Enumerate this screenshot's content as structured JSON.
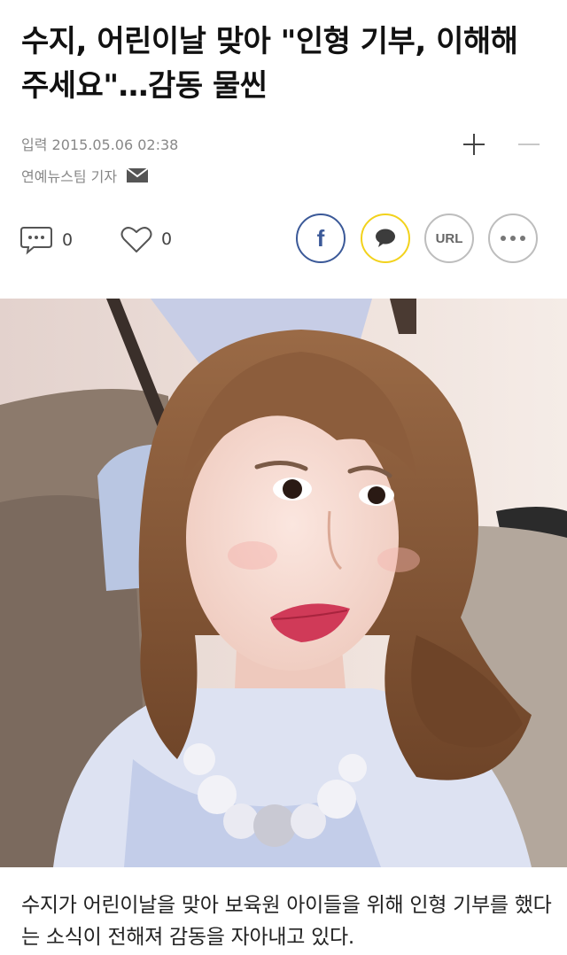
{
  "article": {
    "headline": "수지, 어린이날 맞아 \"인형 기부, 이해해 주세요\"…감동 물씬",
    "date_label": "입력 2015.05.06 02:38",
    "author": "연예뉴스팀 기자",
    "body_text": "수지가 어린이날을 맞아 보육원 아이들을 위해 인형 기부를 했다는 소식이 전해져 감동을 자아내고 있다."
  },
  "font_controls": {
    "increase_icon": "plus-icon",
    "decrease_icon": "minus-icon"
  },
  "engagement": {
    "comment_count": "0",
    "like_count": "0"
  },
  "share": {
    "facebook_glyph": "f",
    "url_label": "URL",
    "facebook_color": "#3b5998",
    "kakao_color": "#f2d21c"
  },
  "photo": {
    "icon": "photo-image"
  }
}
